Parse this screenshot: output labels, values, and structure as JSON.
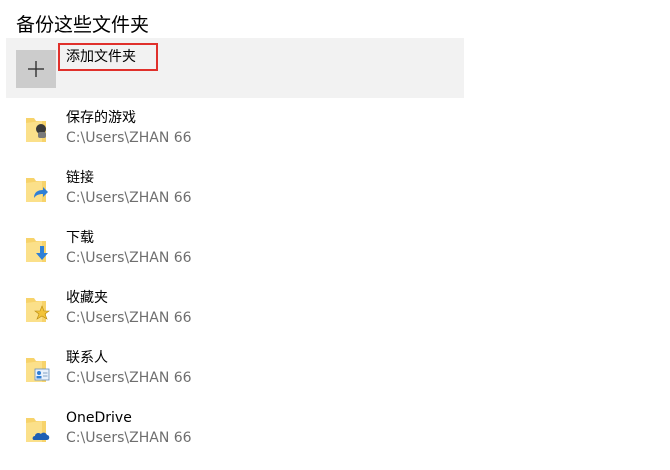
{
  "section": {
    "title": "备份这些文件夹"
  },
  "add_folder": {
    "icon": "plus-icon",
    "label": "添加文件夹",
    "highlight_color": "#e0302b"
  },
  "folders": [
    {
      "name": "保存的游戏",
      "path": "C:\\Users\\ZHAN 66",
      "icon": "saved-games-folder-icon"
    },
    {
      "name": "链接",
      "path": "C:\\Users\\ZHAN 66",
      "icon": "links-folder-icon"
    },
    {
      "name": "下载",
      "path": "C:\\Users\\ZHAN 66",
      "icon": "downloads-folder-icon"
    },
    {
      "name": "收藏夹",
      "path": "C:\\Users\\ZHAN 66",
      "icon": "favorites-folder-icon"
    },
    {
      "name": "联系人",
      "path": "C:\\Users\\ZHAN 66",
      "icon": "contacts-folder-icon"
    },
    {
      "name": "OneDrive",
      "path": "C:\\Users\\ZHAN 66",
      "icon": "onedrive-folder-icon"
    }
  ]
}
